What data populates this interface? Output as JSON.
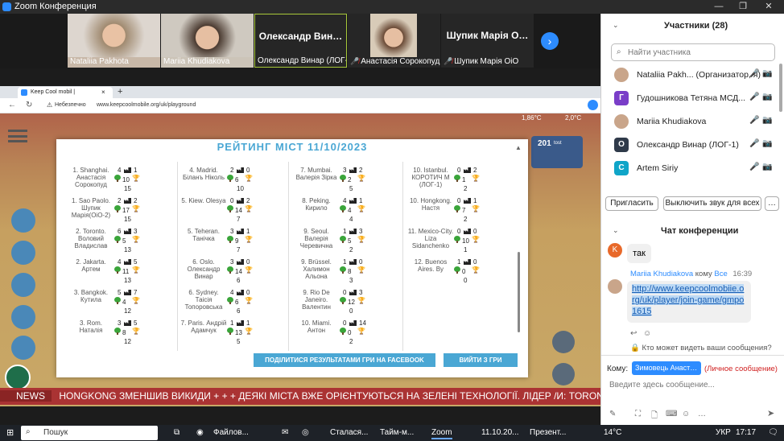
{
  "window": {
    "title": "Zoom Конференция"
  },
  "videos": [
    {
      "name": "Nataliia Pakhota",
      "muted": false
    },
    {
      "name": "Mariia Khudiakova",
      "muted": false
    },
    {
      "name": "Олександр Винар (ЛОГ-1)",
      "muted": false,
      "big": "Олександр Вин…"
    },
    {
      "name": "Анастасія Сорокопуд",
      "muted": true
    },
    {
      "name": "Шупик Марія ОіО",
      "muted": true,
      "big": "Шупик Марія О…"
    }
  ],
  "browser": {
    "tab_title": "Keep Cool mobil |",
    "security": "Небезпечно",
    "url": "www.keepcoolmobile.org/uk/playground"
  },
  "game": {
    "temp_left": "1,86°C",
    "temp_right": "2,0°C",
    "score": "201",
    "score_unit": "tost",
    "news_label": "NEWS",
    "news_ticker": "HONGKONG ЗМЕНШИВ ВИКИДИ + + + ДЕЯКІ МІСТА ВЖЕ ОРІЄНТУЮТЬСЯ НА ЗЕЛЕНІ ТЕХНОЛОГІЇ. ЛІДЕР /И: TORONTO ОТРИМУ"
  },
  "modal": {
    "title": "РЕЙТИНГ МІСТ 11/10/2023",
    "share_button": "ПОДІЛИТИСЯ РЕЗУЛЬТАТАМИ ГРИ НА FACEBOOK",
    "exit_button": "ВИЙТИ З ГРИ",
    "cities": [
      {
        "label": "1. Shanghai. Анастасія Сорокопуд",
        "a": "4",
        "b": "1",
        "c": "10",
        "d": "15"
      },
      {
        "label": "1. Sao Paolo. Шупик Марія(ОіО-2)",
        "a": "2",
        "b": "2",
        "c": "17",
        "d": "15"
      },
      {
        "label": "2. Toronto. Воловий Владислав",
        "a": "6",
        "b": "3",
        "c": "5",
        "d": "13"
      },
      {
        "label": "2. Jakarta. Артем",
        "a": "4",
        "b": "5",
        "c": "11",
        "d": "13"
      },
      {
        "label": "3. Bangkok. Кутила",
        "a": "5",
        "b": "7",
        "c": "4",
        "d": "12"
      },
      {
        "label": "3. Rom. Наталія",
        "a": "3",
        "b": "5",
        "c": "8",
        "d": "12"
      },
      {
        "label": "4. Madrid. Біланъ Ніколь",
        "a": "2",
        "b": "0",
        "c": "6",
        "d": "10"
      },
      {
        "label": "5. Kiew. Olesya",
        "a": "0",
        "b": "2",
        "c": "14",
        "d": "7"
      },
      {
        "label": "5. Teheran. Танічка",
        "a": "3",
        "b": "1",
        "c": "9",
        "d": "7"
      },
      {
        "label": "6. Oslo. Олександр Винар",
        "a": "3",
        "b": "0",
        "c": "14",
        "d": "6"
      },
      {
        "label": "6. Sydney. Таісія Топоровська",
        "a": "4",
        "b": "0",
        "c": "6",
        "d": "6"
      },
      {
        "label": "7. Paris. Андрій Адамчук",
        "a": "1",
        "b": "1",
        "c": "13",
        "d": "5"
      },
      {
        "label": "7. Mumbai. Валерія Зірка",
        "a": "3",
        "b": "2",
        "c": "2",
        "d": "5"
      },
      {
        "label": "8. Peking. Кирило",
        "a": "4",
        "b": "1",
        "c": "4",
        "d": "4"
      },
      {
        "label": "9. Seoul. Валерія Черевична",
        "a": "1",
        "b": "3",
        "c": "5",
        "d": "2"
      },
      {
        "label": "9. Brüssel. Халимон Альона",
        "a": "1",
        "b": "0",
        "c": "8",
        "d": "3"
      },
      {
        "label": "9. Rio De Janeiro. Валентин",
        "a": "0",
        "b": "3",
        "c": "12",
        "d": "0"
      },
      {
        "label": "10. Miami. Антон",
        "a": "0",
        "b": "14",
        "c": "0",
        "d": "2"
      },
      {
        "label": "10. Istanbul. КОРОТИЧ М (ЛОГ-1)",
        "a": "0",
        "b": "2",
        "c": "1",
        "d": "2"
      },
      {
        "label": "10. Hongkong. Настя",
        "a": "0",
        "b": "1",
        "c": "7",
        "d": "2"
      },
      {
        "label": "11. Mexico-City. Liza Sidanchenko",
        "a": "0",
        "b": "0",
        "c": "10",
        "d": "1"
      },
      {
        "label": "12. Buenos Aires. Ву",
        "a": "1",
        "b": "0",
        "c": "0",
        "d": "0"
      }
    ]
  },
  "panel": {
    "participants_title": "Участники (28)",
    "search_placeholder": "Найти участника",
    "participants": [
      {
        "name": "Nataliia Pakh... (Организатор, я)",
        "avatar": "",
        "color": "#c9a58a"
      },
      {
        "name": "Гудошникова Тетяна МСД...",
        "avatar": "Г",
        "color": "#7a3ec8"
      },
      {
        "name": "Mariia Khudiakova",
        "avatar": "",
        "color": "#c9a58a"
      },
      {
        "name": "Олександр Винар (ЛОГ-1)",
        "avatar": "О",
        "color": "#2f3a4a"
      },
      {
        "name": "Artem Siriy",
        "avatar": "C",
        "color": "#0fa5c8"
      }
    ],
    "invite_button": "Пригласить",
    "mute_all_button": "Выключить звук для всех",
    "more_button": "…",
    "chat_title": "Чат конференции",
    "messages": [
      {
        "sender_initial": "K",
        "text": "так"
      },
      {
        "sender": "Mariia Khudiakova",
        "to_label": "кому",
        "to": "Все",
        "time": "16:39",
        "link": "http://www.keepcoolmobiie.org/uk/player/join-game/gmpo1615"
      }
    ],
    "who_can_see": "Кто может видеть ваши сообщения?",
    "to_label": "Кому:",
    "to_value": "Зимовець Анаст…",
    "private_label": "(Личное сообщение)",
    "input_placeholder": "Введите здесь сообщение..."
  },
  "taskbar": {
    "search": "Пошук",
    "apps": [
      "Файлов...",
      "Сталася...",
      "Тайм-м...",
      "Zoom",
      "11.10.20...",
      "Презент..."
    ],
    "weather": "14°C",
    "lang": "УКР",
    "time": "17:17"
  }
}
